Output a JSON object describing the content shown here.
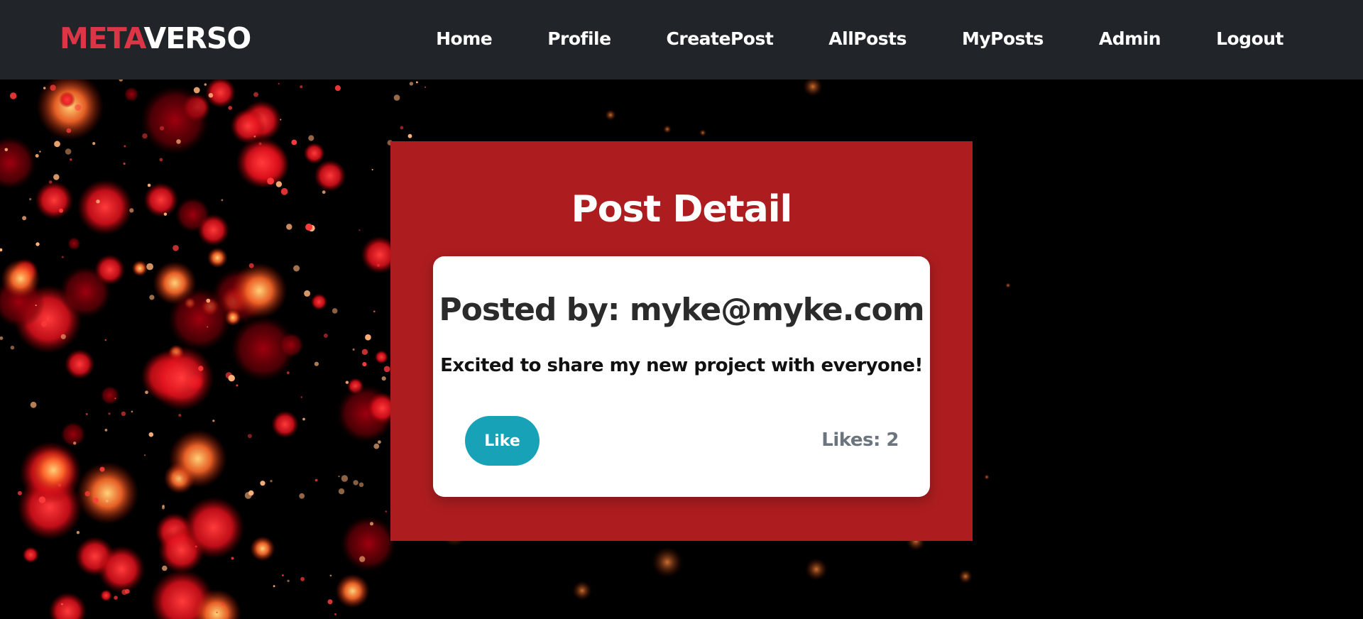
{
  "navbar": {
    "brand_part1": "META",
    "brand_part2": "VERSO",
    "links": [
      "Home",
      "Profile",
      "CreatePost",
      "AllPosts",
      "MyPosts",
      "Admin",
      "Logout"
    ]
  },
  "page": {
    "title": "Post Detail"
  },
  "post": {
    "author_line": "Posted by: myke@myke.com",
    "content": "Excited to share my new project with everyone!",
    "like_label": "Like",
    "likes_text": "Likes: 2"
  },
  "colors": {
    "navbar_bg": "#212529",
    "brand_accent": "#dc3545",
    "card_red": "#ad1d1f",
    "like_button": "#17a2b8",
    "likes_text": "#6c757d"
  }
}
